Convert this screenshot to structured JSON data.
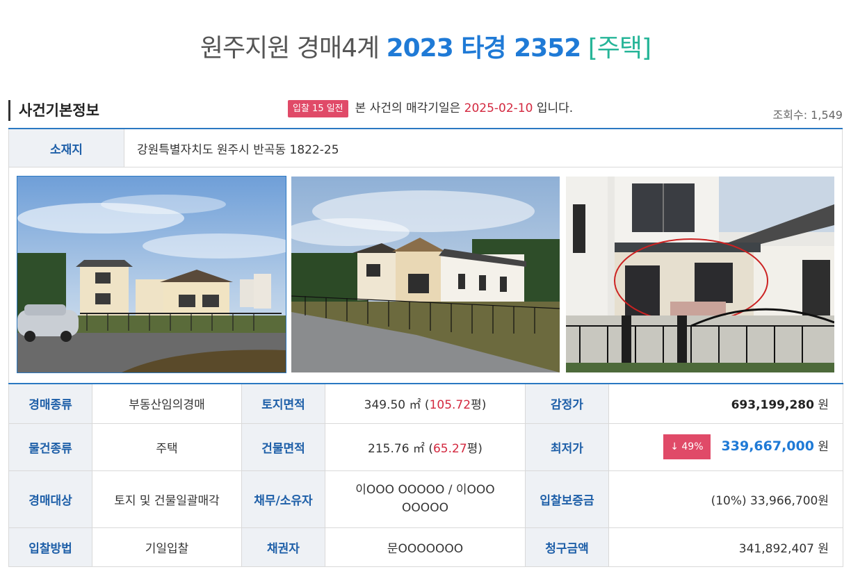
{
  "header": {
    "court": "원주지원 경매4계",
    "case_no": "2023 타경 2352",
    "kind": "[주택]"
  },
  "basic": {
    "title": "사건기본정보",
    "badge": "입찰 15 일전",
    "notice_pre": "본 사건의 매각기일은",
    "sale_date": "2025-02-10",
    "notice_post": "입니다.",
    "views": "조회수: 1,549"
  },
  "address": {
    "label": "소재지",
    "value": "강원특별자치도 원주시 반곡동 1822-25"
  },
  "colors": {
    "accent": "#1f7ad6",
    "badge": "#e04a68",
    "label_bg": "#eef1f5",
    "kind": "#26b598"
  },
  "info": {
    "r1": {
      "l1": "경매종류",
      "v1": "부동산임의경매",
      "l2": "토지면적",
      "v2_pre": "349.50 ㎡ (",
      "v2_py": "105.72",
      "v2_post": "평)",
      "l3": "감정가",
      "v3": "693,199,280",
      "unit": "원"
    },
    "r2": {
      "l1": "물건종류",
      "v1": "주택",
      "l2": "건물면적",
      "v2_pre": "215.76 ㎡ (",
      "v2_py": "65.27",
      "v2_post": "평)",
      "l3": "최저가",
      "drop": "↓ 49%",
      "v3": "339,667,000",
      "unit": "원"
    },
    "r3": {
      "l1": "경매대상",
      "v1": "토지 및 건물일괄매각",
      "l2": "채무/소유자",
      "v2a": "이OOO OOOOO / 이OOO",
      "v2b": "OOOOO",
      "l3": "입찰보증금",
      "v3": "(10%) 33,966,700원"
    },
    "r4": {
      "l1": "입찰방법",
      "v1": "기일입찰",
      "l2": "채권자",
      "v2": "문OOOOOOO",
      "l3": "청구금액",
      "v3": "341,892,407",
      "unit": "원"
    }
  }
}
